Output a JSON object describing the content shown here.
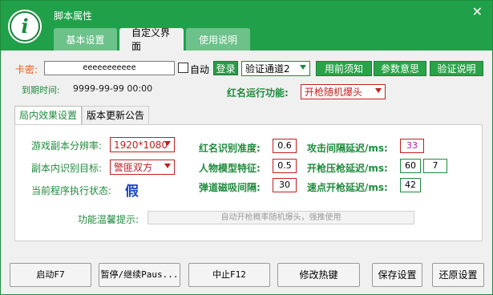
{
  "window": {
    "title": "脚本属性",
    "logo_glyph": "i",
    "close_glyph": "✕",
    "accent": "#21a04a"
  },
  "tabs": [
    {
      "label": "基本设置",
      "active": false
    },
    {
      "label": "自定义界面",
      "active": true
    },
    {
      "label": "使用说明",
      "active": false
    }
  ],
  "card": {
    "label": "卡密:",
    "value": "eeeeeeeeeee",
    "auto_label": "自动",
    "login_label": "登录",
    "channel": "验证通道2"
  },
  "actions": {
    "before_use": "用前须知",
    "param_meaning": "参数意思",
    "verify_help": "验证说明"
  },
  "expire": {
    "label": "到期时间:",
    "value": "9999-99-99 00:00"
  },
  "redname": {
    "label": "红名运行功能:",
    "value": "开枪随机爆头"
  },
  "panel_tabs": [
    {
      "label": "局内效果设置",
      "active": true
    },
    {
      "label": "版本更新公告",
      "active": false
    }
  ],
  "settings": {
    "resolution_label": "游戏副本分辨率:",
    "resolution_value": "1920*1080",
    "target_label": "副本内识别目标:",
    "target_value": "警匪双方",
    "status_label": "当前程序执行状态:",
    "status_value": "假",
    "redname_acc_label": "红名识别准度:",
    "redname_acc_value": "0.6",
    "model_label": "人物模型特征:",
    "model_value": "0.5",
    "magnet_label": "弹道磁吸间隔:",
    "magnet_value": "30",
    "atk_delay_label": "攻击间隔延迟/ms:",
    "atk_delay_value": "33",
    "press_delay_label": "开枪压枪延迟/ms:",
    "press_delay_value1": "60",
    "press_delay_value2": "7",
    "burst_delay_label": "速点开枪延迟/ms:",
    "burst_delay_value": "42",
    "tip_label": "功能温馨提示:",
    "tip_value": "自动开枪概率随机爆头，强推使用"
  },
  "bottom": {
    "start": "启动F7",
    "pause": "暂停/继续Paus...",
    "stop": "中止F12",
    "hotkey": "修改热键",
    "save": "保存设置",
    "restore": "还原设置"
  }
}
